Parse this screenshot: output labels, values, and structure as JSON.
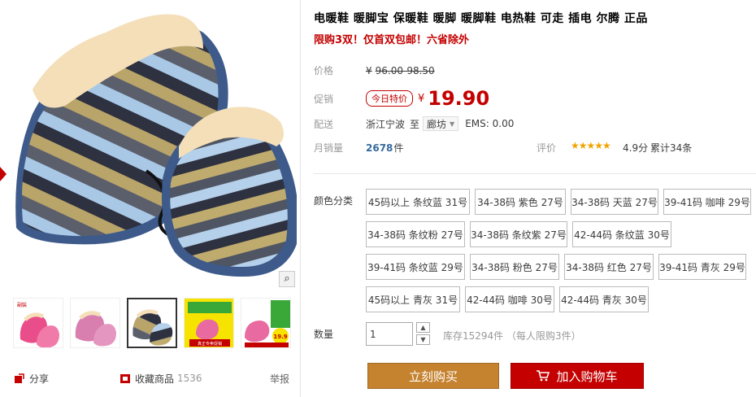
{
  "product": {
    "title": "电暖鞋 暖脚宝 保暖鞋 暖脚 暖脚鞋 电热鞋 可走 插电 尔腾 正品",
    "promo": "限购3双！仅首双包邮！六省除外"
  },
  "price": {
    "label": "价格",
    "currency": "¥",
    "original": "96.00-98.50"
  },
  "promo_price": {
    "label": "促销",
    "tag": "今日特价",
    "currency": "¥",
    "value": "19.90"
  },
  "shipping": {
    "label": "配送",
    "from": "浙江宁波",
    "to_label": "至",
    "destination": "廊坊",
    "ems": "EMS: 0.00"
  },
  "sales": {
    "label": "月销量",
    "count": "2678",
    "unit": "件"
  },
  "rating": {
    "label": "评价",
    "stars": "★★★★★",
    "score": "4.9分",
    "reviews": "累计34条"
  },
  "color": {
    "label": "颜色分类",
    "options": [
      "45码以上 条纹蓝 31号",
      "34-38码 紫色 27号",
      "34-38码 天蓝 27号",
      "39-41码 咖啡 29号",
      "34-38码 条纹粉 27号",
      "34-38码 条纹紫 27号",
      "42-44码 条纹蓝 30号",
      "39-41码 条纹蓝 29号",
      "34-38码 粉色 27号",
      "34-38码 红色 27号",
      "39-41码 青灰 29号",
      "45码以上 青灰 31号",
      "42-44码 咖啡 30号",
      "42-44码 青灰 30号"
    ]
  },
  "quantity": {
    "label": "数量",
    "value": "1",
    "stock": "库存15294件 （每人限购3件）"
  },
  "actions": {
    "buy_now": "立刻购买",
    "add_to_cart": "加入购物车"
  },
  "gallery": {
    "zoom_icon": "magnifier-icon",
    "thumb4_text": "真正专卖促销",
    "thumb5_price": "19.9",
    "thumb1_label": "副裝"
  },
  "social": {
    "share": "分享",
    "favorite": "收藏商品",
    "favorite_count": "1536",
    "report": "举报"
  },
  "colors": {
    "accent": "#c40000",
    "buy_button": "#c5822f",
    "link_blue": "#346aa0",
    "star": "#f0a400"
  }
}
